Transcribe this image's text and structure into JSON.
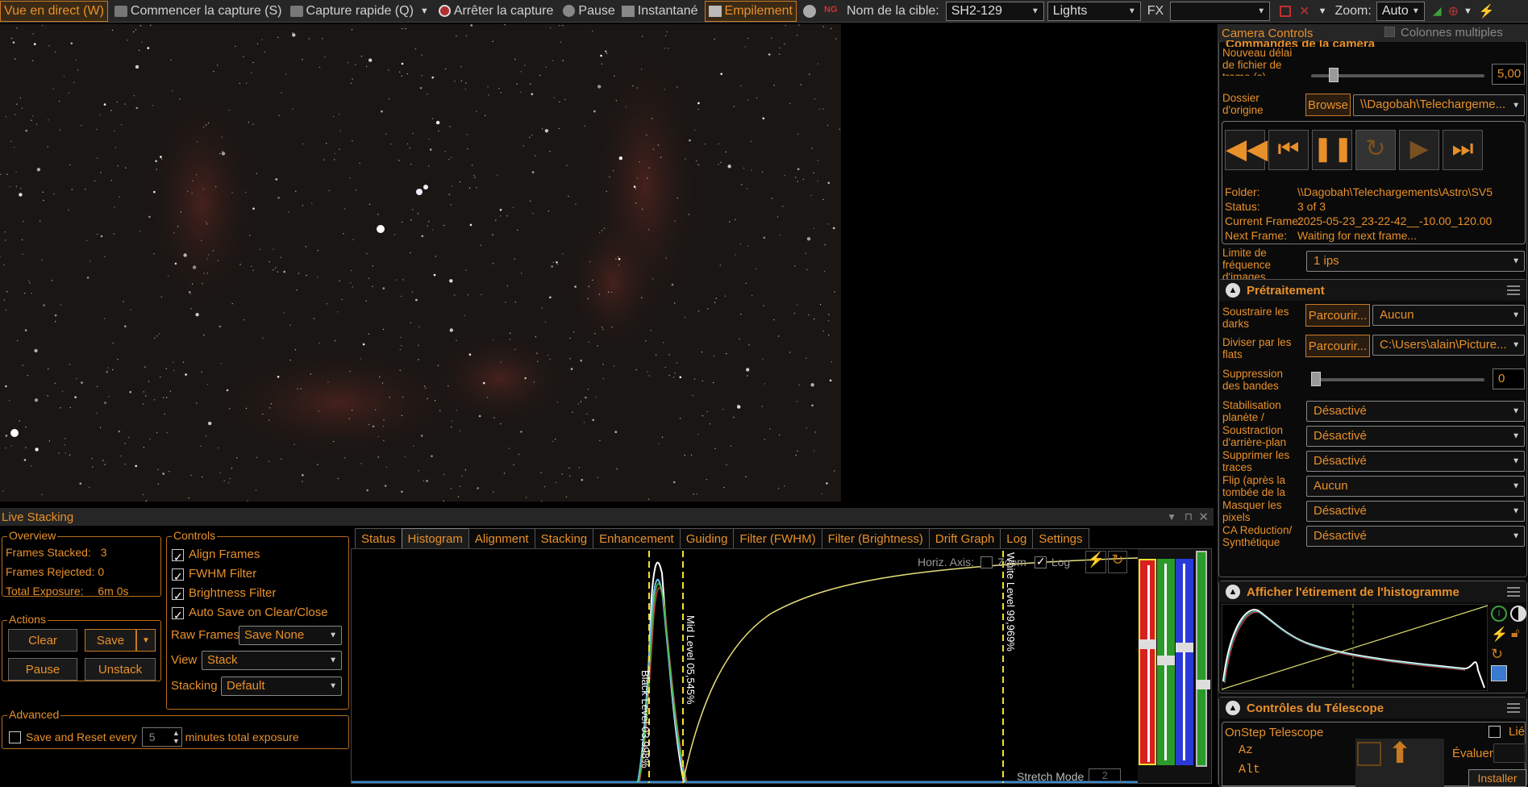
{
  "toolbar": {
    "live_view": "Vue en direct (W)",
    "start_capture": "Commencer la capture (S)",
    "quick_capture": "Capture rapide (Q)",
    "stop_capture": "Arrêter la capture",
    "pause": "Pause",
    "snapshot": "Instantané",
    "stacking": "Empilement",
    "target_label": "Nom de la cible:",
    "target_value": "SH2-129",
    "frame_type": "Lights",
    "fx_label": "FX",
    "fx_value": "",
    "zoom_label": "Zoom:",
    "zoom_value": "Auto"
  },
  "right_panel": {
    "header": "Camera Controls",
    "multi_columns": "Colonnes multiples",
    "camera_section": {
      "title": "Commandes de la caméra",
      "delay_label": "Nouveau délai de fichier de trame (s)",
      "delay_value": "5,00",
      "source_label": "Dossier d'origine",
      "browse": "Browse",
      "source_path": "\\\\Dagobah\\Telechargeme...",
      "info": [
        {
          "k": "Folder:",
          "v": "\\\\Dagobah\\Telechargements\\Astro\\SV5"
        },
        {
          "k": "Status:",
          "v": "3 of 3"
        },
        {
          "k": "Current Frame:",
          "v": "2025-05-23_23-22-42__-10.00_120.00"
        },
        {
          "k": "Next Frame:",
          "v": "Waiting for next frame..."
        }
      ],
      "fps_label": "Limite de fréquence d'images",
      "fps_value": "1 ips"
    },
    "preprocess": {
      "title": "Prétraitement",
      "darks_label": "Soustraire les darks",
      "darks_btn": "Parcourir...",
      "darks_value": "Aucun",
      "flats_label": "Diviser par les flats",
      "flats_btn": "Parcourir...",
      "flats_value": "C:\\Users\\alain\\Picture...",
      "banding_label": "Suppression des bandes",
      "banding_value": "0",
      "rows": [
        {
          "label": "Stabilisation planète / disque",
          "value": "Désactivé"
        },
        {
          "label": "Soustraction d'arrière-plan",
          "value": "Désactivé"
        },
        {
          "label": "Supprimer les traces satellites",
          "value": "Désactivé"
        },
        {
          "label": "Flip (après la tombée de la nuit/à plat)",
          "value": "Aucun"
        },
        {
          "label": "Masquer les pixels exposés",
          "value": "Désactivé"
        },
        {
          "label": "CA Reduction/ Synthétique Bleu",
          "value": "Désactivé"
        }
      ]
    },
    "hist_stretch_title": "Afficher l'étirement de l'histogramme",
    "telescope": {
      "title": "Contrôles du Télescope",
      "name": "OnStep Telescope",
      "linked": "Lié",
      "az": "Az",
      "alt": "Alt",
      "evaluate": "Évaluer:",
      "install": "Installer"
    }
  },
  "live_stacking": {
    "title": "Live Stacking",
    "overview": {
      "title": "Overview",
      "stacked_label": "Frames Stacked:",
      "stacked_value": "3",
      "rejected_label": "Frames Rejected:",
      "rejected_value": "0",
      "exposure_label": "Total Exposure:",
      "exposure_value": "6m 0s"
    },
    "actions": {
      "title": "Actions",
      "clear": "Clear",
      "save": "Save",
      "pause": "Pause",
      "unstack": "Unstack"
    },
    "advanced": {
      "title": "Advanced",
      "save_reset": "Save and Reset every",
      "minutes_value": "5",
      "minutes_suffix": "minutes total exposure"
    },
    "controls": {
      "title": "Controls",
      "checks": [
        "Align Frames",
        "FWHM Filter",
        "Brightness Filter",
        "Auto Save on Clear/Close"
      ],
      "raw_label": "Raw Frames",
      "raw_value": "Save None",
      "view_label": "View",
      "view_value": "Stack",
      "stacking_label": "Stacking",
      "stacking_value": "Default"
    },
    "tabs": [
      "Status",
      "Histogram",
      "Alignment",
      "Stacking",
      "Enhancement",
      "Guiding",
      "Filter (FWHM)",
      "Filter (Brightness)",
      "Drift Graph",
      "Log",
      "Settings"
    ],
    "histogram": {
      "horiz_axis": "Horiz. Axis:",
      "zoom": "Zoom",
      "log": "Log",
      "black_level": "Black Level  03,998%",
      "mid_level": "Mid Level  05,545%",
      "white_level": "White Level  99,969%",
      "stretch_mode": "Stretch Mode",
      "stretch_value": "2"
    }
  },
  "colors": {
    "accent": "#e8902a",
    "bg": "#000000",
    "panel": "#262626"
  }
}
